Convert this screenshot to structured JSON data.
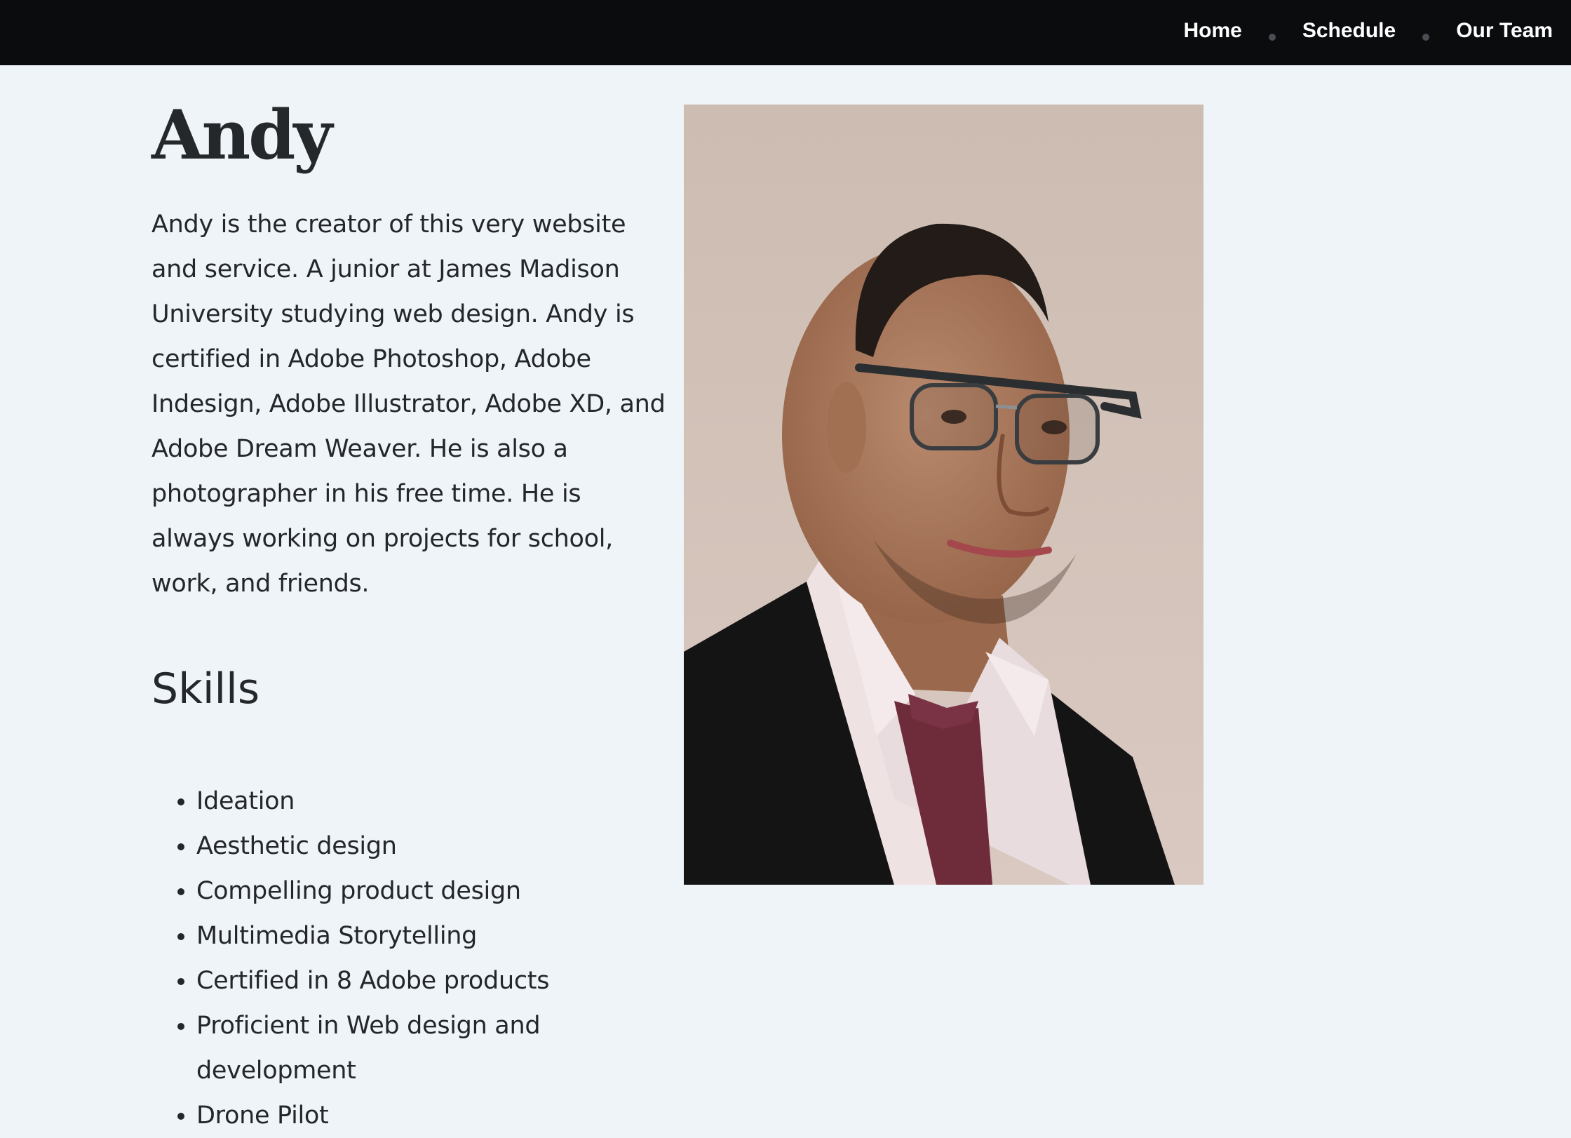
{
  "nav": {
    "items": [
      {
        "label": "Home"
      },
      {
        "label": "Schedule"
      },
      {
        "label": "Our Team"
      }
    ]
  },
  "profile": {
    "name": "Andy",
    "bio": "Andy is the creator of this very website and service. A junior at James Madison University studying web design. Andy is certified in Adobe Photoshop, Adobe Indesign, Adobe Illustrator, Adobe XD, and Adobe Dream Weaver. He is also a photographer in his free time. He is always working on projects for school, work, and friends.",
    "skills_title": "Skills",
    "skills": [
      "Ideation",
      "Aesthetic design",
      "Compelling product design",
      "Multimedia Storytelling",
      "Certified in 8 Adobe products",
      "Proficient in Web design and development",
      "Drone Pilot"
    ]
  },
  "colors": {
    "topbar": "#0b0c0e",
    "background": "#eff4f8",
    "text": "#23262a"
  }
}
